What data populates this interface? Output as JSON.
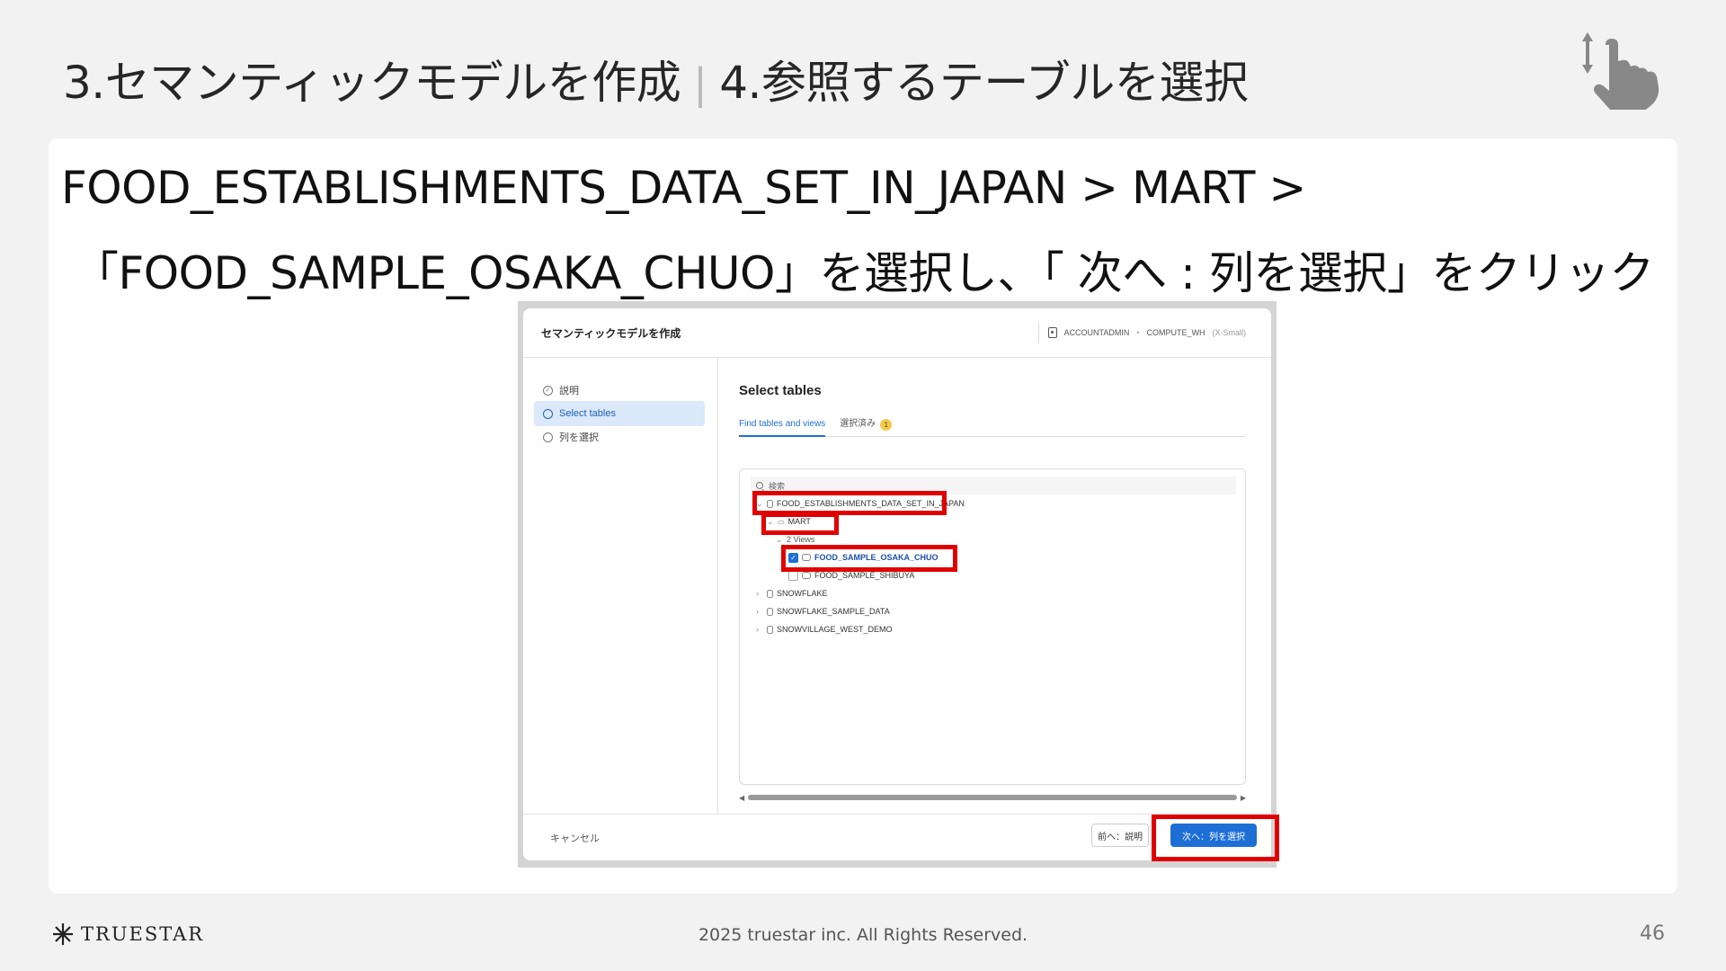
{
  "slide": {
    "title_left": "3.セマンティックモデルを作成",
    "title_sep": "|",
    "title_right": "4.参照するテーブルを選択",
    "instruction_line1": "FOOD_ESTABLISHMENTS_DATA_SET_IN_JAPAN > MART >",
    "instruction_line2": "「FOOD_SAMPLE_OSAKA_CHUO」を選択し、「 次へ : 列を選択」をクリック",
    "corner_icon": "swipe-hand-icon"
  },
  "dialog": {
    "title": "セマンティックモデルを作成",
    "role": "ACCOUNTADMIN",
    "separator": "•",
    "warehouse": "COMPUTE_WH",
    "warehouse_size": "(X-Small)",
    "steps": [
      {
        "label": "説明",
        "state": "done"
      },
      {
        "label": "Select tables",
        "state": "active"
      },
      {
        "label": "列を選択",
        "state": "pending"
      }
    ],
    "main_title": "Select tables",
    "tabs": [
      {
        "label": "Find tables and views"
      },
      {
        "label": "選択済み",
        "badge": "1"
      }
    ],
    "search_placeholder": "検索",
    "tree": {
      "db_japan": "FOOD_ESTABLISHMENTS_DATA_SET_IN_JAPAN",
      "schema_mart": "MART",
      "views_group": "2 Views",
      "view_osaka": "FOOD_SAMPLE_OSAKA_CHUO",
      "view_shibuya": "FOOD_SAMPLE_SHIBUYA",
      "db_snowflake": "SNOWFLAKE",
      "db_sample": "SNOWFLAKE_SAMPLE_DATA",
      "db_village": "SNOWVILLAGE_WEST_DEMO"
    },
    "cancel_label": "キャンセル",
    "back_label": "前へ：説明",
    "next_label": "次へ：列を選択"
  },
  "footer": {
    "logo_text": "TRUESTAR",
    "copyright": "2025 truestar inc. All Rights Reserved.",
    "page_number": "46"
  },
  "colors": {
    "highlight": "#e10000",
    "accent": "#1d6fd6"
  }
}
